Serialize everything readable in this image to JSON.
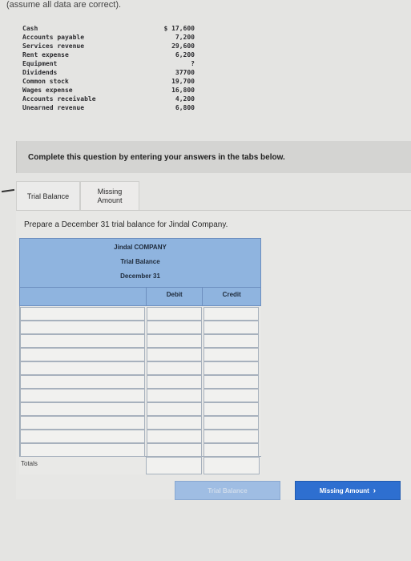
{
  "intro": "(assume all data are correct).",
  "accounts": [
    {
      "name": "Cash",
      "value": "$ 17,600"
    },
    {
      "name": "Accounts payable",
      "value": "7,200"
    },
    {
      "name": "Services revenue",
      "value": "29,600"
    },
    {
      "name": "Rent expense",
      "value": "6,200"
    },
    {
      "name": "Equipment",
      "value": "?"
    },
    {
      "name": "Dividends",
      "value": "37700"
    },
    {
      "name": "Common stock",
      "value": "19,700"
    },
    {
      "name": "Wages expense",
      "value": "16,800"
    },
    {
      "name": "Accounts receivable",
      "value": "4,200"
    },
    {
      "name": "Unearned revenue",
      "value": "6,800"
    }
  ],
  "banner": "Complete this question by entering your answers in the tabs below.",
  "tabs": [
    {
      "label": "Trial Balance"
    },
    {
      "label_line1": "Missing",
      "label_line2": "Amount"
    }
  ],
  "instruction": "Prepare a December 31 trial balance for Jindal Company.",
  "trial_balance": {
    "company": "Jindal COMPANY",
    "title": "Trial Balance",
    "date": "December 31",
    "col_debit": "Debit",
    "col_credit": "Credit",
    "totals_label": "Totals"
  },
  "nav": {
    "prev": "Trial Balance",
    "next": "Missing Amount",
    "next_icon": "chevron-right-icon"
  }
}
